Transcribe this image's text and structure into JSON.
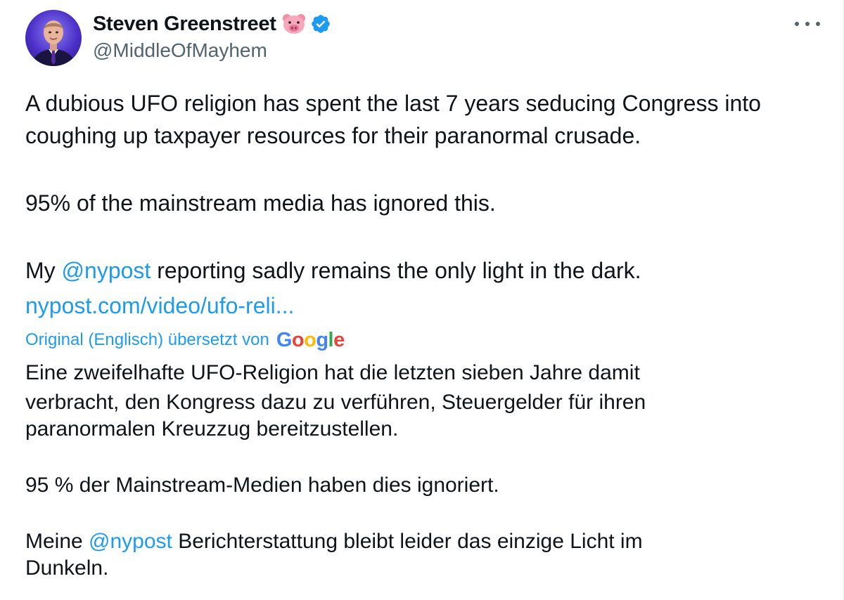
{
  "author": {
    "display_name": "Steven Greenstreet",
    "handle": "@MiddleOfMayhem",
    "name_emoji": "pig-face-emoji",
    "verified_badge_color": "#1d9bf0"
  },
  "more_menu": {
    "icon": "more-horizontal-icon"
  },
  "tweet": {
    "line1": "A dubious UFO religion has spent the last 7 years seducing Congress into",
    "line2": "coughing up taxpayer resources for their paranormal crusade.",
    "line3": "95% of the mainstream media has ignored this.",
    "line4_prefix": "My ",
    "line4_mention": "@nypost",
    "line4_suffix": " reporting sadly remains the only light in the dark.",
    "link": "nypost.com/video/ufo-reli..."
  },
  "translation": {
    "note": "Original (Englisch) übersetzt von",
    "provider_letters": [
      "G",
      "o",
      "o",
      "g",
      "l",
      "e"
    ],
    "line1": "Eine zweifelhafte UFO-Religion hat die letzten sieben Jahre damit",
    "line2": "verbracht, den Kongress dazu zu verführen, Steuergelder für ihren",
    "line3": "paranormalen Kreuzzug bereitzustellen.",
    "line4": "95 % der Mainstream-Medien haben dies ignoriert.",
    "line5_prefix": "Meine ",
    "line5_mention": "@nypost",
    "line5_suffix": " Berichterstattung bleibt leider das einzige Licht im",
    "line6": "Dunkeln."
  },
  "colors": {
    "link": "#1d9bf0",
    "text": "#0f1419",
    "secondary": "#536471"
  }
}
